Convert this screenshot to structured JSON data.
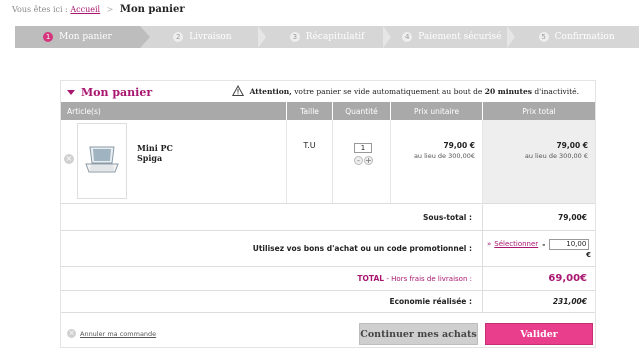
{
  "breadcrumb": {
    "prefix": "Vous êtes ici :",
    "home": "Accueil",
    "separator": ">",
    "current": "Mon panier"
  },
  "steps": [
    {
      "num": "1",
      "label": "Mon panier",
      "active": true
    },
    {
      "num": "2",
      "label": "Livraison",
      "active": false
    },
    {
      "num": "3",
      "label": "Récapitulatif",
      "active": false
    },
    {
      "num": "4",
      "label": "Paiement sécurisé",
      "active": false
    },
    {
      "num": "5",
      "label": "Confirmation",
      "active": false
    }
  ],
  "cart": {
    "title": "Mon panier",
    "warning": {
      "lead": "Attention,",
      "text": "votre panier se vide automatiquement au bout de",
      "duration": "20 minutes",
      "tail": "d'inactivité."
    },
    "columns": {
      "article": "Article(s)",
      "size": "Taille",
      "quantity": "Quantité",
      "unit_price": "Prix unitaire",
      "total_price": "Prix total"
    },
    "items": [
      {
        "name_line1": "Mini PC",
        "name_line2": "Spiga",
        "size": "T.U",
        "quantity": "1",
        "unit_price": "79,00 €",
        "unit_old": "au lieu de 300,00€",
        "total_price": "79,00 €",
        "total_old": "au lieu de 300,00 €"
      }
    ],
    "subtotal": {
      "label": "Sous-total :",
      "value": "79,00€"
    },
    "promo": {
      "label": "Utilisez vos bons d'achat ou un code promotionnel :",
      "arrow": "»",
      "select_label": "Sélectionner",
      "minus": "-",
      "value": "10,00",
      "currency": "€"
    },
    "total": {
      "label": "TOTAL",
      "note": "- Hors frais de livraison :",
      "value": "69,00€"
    },
    "economy": {
      "label": "Economie réalisée :",
      "value": "231,00€"
    },
    "cancel_label": "Annuler ma commande",
    "continue_label": "Continuer mes achats",
    "validate_label": "Valider"
  },
  "colors": {
    "accent": "#a8166f",
    "button_pink": "#e83e8c",
    "header_gray": "#a9a9a9"
  }
}
